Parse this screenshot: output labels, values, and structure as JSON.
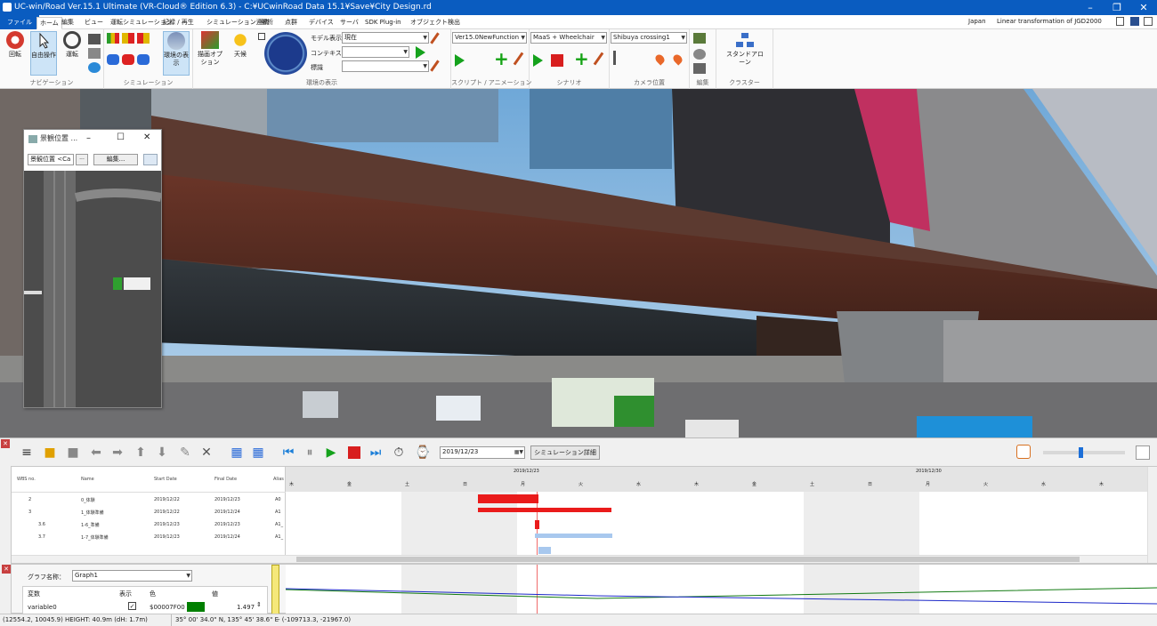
{
  "window": {
    "title": "UC-win/Road Ver.15.1 Ultimate (VR-Cloud® Edition 6.3) - C:¥UCwinRoad Data 15.1¥Save¥City Design.rd"
  },
  "tabs": [
    "ファイル",
    "ホーム",
    "編集",
    "ビュー",
    "運転シミュレーション",
    "記録 / 再生",
    "シミュレーション連携",
    "解析",
    "点群",
    "デバイス",
    "サーバ",
    "SDK Plug-in",
    "オブジェクト検出"
  ],
  "tabs_right": {
    "region": "Japan",
    "transform": "Linear transformation of JGD2000"
  },
  "ribbon": {
    "nav": {
      "rotate": "回転",
      "free": "自由操作",
      "drive": "運転",
      "group": "ナビゲーション"
    },
    "sim": {
      "group": "シミュレーション"
    },
    "env": {
      "env_btn": "環境の表示",
      "draw": "描画オプション",
      "weather": "天候",
      "model_label": "モデル表示",
      "model_val": "現在",
      "context_label": "コンテキスト",
      "context_val": "",
      "std_label": "標識",
      "std_val": "",
      "group": "環境の表示"
    },
    "script": {
      "val": "Ver15.0NewFunction",
      "group": "スクリプト / アニメーション"
    },
    "scenario": {
      "val": "MaaS + Wheelchair",
      "group": "シナリオ"
    },
    "camera": {
      "val": "Shibuya crossing1",
      "group": "カメラ位置"
    },
    "edit": {
      "group": "編集"
    },
    "cluster": {
      "btn": "スタンドアローン",
      "group": "クラスター"
    }
  },
  "mapwin": {
    "title": "景観位置 ...",
    "combo": "景観位置 <Ca",
    "dots": "...",
    "edit_btn": "編集..."
  },
  "timeline": {
    "date": "2019/12/23",
    "details_btn": "シミュレーション詳細"
  },
  "gantt": {
    "headers": [
      "WBS no.",
      "Name",
      "Start Date",
      "Final Date",
      "Alias"
    ],
    "date_labels": [
      "2019/12/23",
      "2019/12/30"
    ],
    "day_labels": [
      "木",
      "金",
      "土",
      "日",
      "月",
      "火",
      "水",
      "木",
      "金",
      "土",
      "日",
      "月",
      "火",
      "水",
      "木"
    ],
    "rows": [
      {
        "wbs": "2",
        "name": "0_体験",
        "start": "2019/12/22",
        "end": "2019/12/23",
        "alias": "A0"
      },
      {
        "wbs": "3",
        "name": "1_体験準備",
        "start": "2019/12/22",
        "end": "2019/12/24",
        "alias": "A1"
      },
      {
        "wbs": "3.6",
        "name": "1-6_準備",
        "start": "2019/12/23",
        "end": "2019/12/23",
        "alias": "A1_"
      },
      {
        "wbs": "3.7",
        "name": "1-7_体験準備",
        "start": "2019/12/23",
        "end": "2019/12/24",
        "alias": "A1_"
      }
    ]
  },
  "graph": {
    "name_label": "グラフ名称：",
    "name_val": "Graph1",
    "col_var": "変数",
    "col_show": "表示",
    "col_color": "色",
    "col_value": "値",
    "var_name": "variable0",
    "var_checked": "✓",
    "var_color_text": "$00007F00",
    "var_value": "1.497",
    "var_color": "#007f00"
  },
  "status": {
    "pos": "(12554.2, 10045.9)  HEIGHT: 40.9m (dH: 1.7m)",
    "latlon": "35° 00' 34.0\" N, 135° 45' 38.6\" E",
    "xy": "- (-109713.3, -21967.0)"
  }
}
